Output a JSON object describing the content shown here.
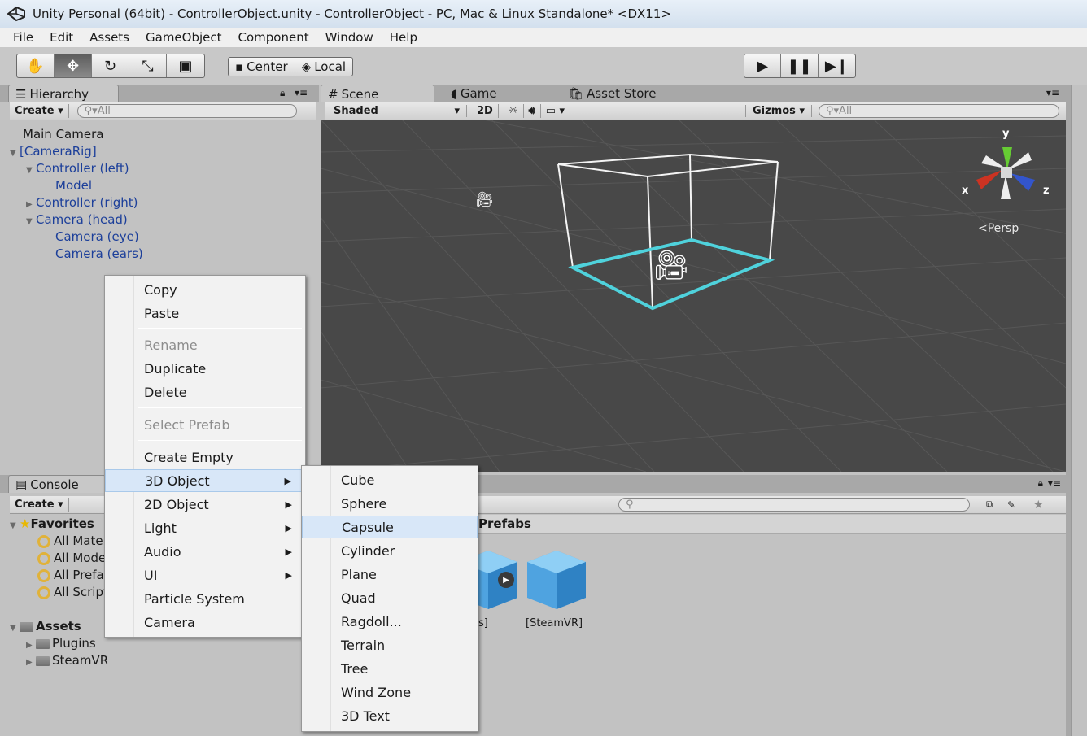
{
  "title": "Unity Personal (64bit) - ControllerObject.unity - ControllerObject - PC, Mac & Linux Standalone* <DX11>",
  "menu": [
    "File",
    "Edit",
    "Assets",
    "GameObject",
    "Component",
    "Window",
    "Help"
  ],
  "toolbar": {
    "tools": [
      "hand-tool-icon",
      "move-tool-icon",
      "rotate-tool-icon",
      "scale-tool-icon",
      "rect-tool-icon"
    ],
    "pivot_center": "Center",
    "pivot_local": "Local",
    "play_icons": [
      "play-icon",
      "pause-icon",
      "step-icon"
    ]
  },
  "hierarchy": {
    "tab": "Hierarchy",
    "create": "Create",
    "search_placeholder": "All",
    "items": [
      "Main Camera",
      "[CameraRig]",
      "Controller (left)",
      "Model",
      "Controller (right)",
      "Camera (head)",
      "Camera (eye)",
      "Camera (ears)"
    ]
  },
  "scene": {
    "tabs": [
      "Scene",
      "Game",
      "Asset Store"
    ],
    "shaded": "Shaded",
    "btn_2d": "2D",
    "gizmos": "Gizmos",
    "search_placeholder": "All",
    "persp": "Persp",
    "axis_y": "y",
    "axis_x": "x",
    "axis_z": "z"
  },
  "console": {
    "tab": "Console",
    "create": "Create"
  },
  "project": {
    "favorites": "Favorites",
    "fav_items": [
      "All Materials",
      "All Models",
      "All Prefabs",
      "All Scripts"
    ],
    "assets": "Assets",
    "folders": [
      "Plugins",
      "SteamVR"
    ],
    "breadcrumb": "Prefabs",
    "prefab_label_partial": "s]",
    "prefab_label": "[SteamVR]"
  },
  "context_menu": {
    "items": [
      "Copy",
      "Paste",
      "Rename",
      "Duplicate",
      "Delete",
      "Select Prefab",
      "Create Empty",
      "3D Object",
      "2D Object",
      "Light",
      "Audio",
      "UI",
      "Particle System",
      "Camera"
    ]
  },
  "submenu": {
    "items": [
      "Cube",
      "Sphere",
      "Capsule",
      "Cylinder",
      "Plane",
      "Quad",
      "Ragdoll...",
      "Terrain",
      "Tree",
      "Wind Zone",
      "3D Text"
    ]
  }
}
